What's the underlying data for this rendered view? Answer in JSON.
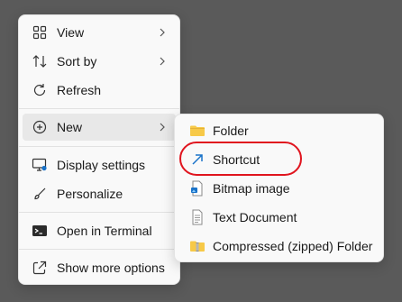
{
  "main_menu": {
    "items": [
      {
        "label": "View",
        "icon": "grid-icon",
        "has_submenu": true
      },
      {
        "label": "Sort by",
        "icon": "sort-icon",
        "has_submenu": true
      },
      {
        "label": "Refresh",
        "icon": "refresh-icon",
        "has_submenu": false
      },
      {
        "label": "New",
        "icon": "plus-circle-icon",
        "has_submenu": true
      },
      {
        "label": "Display settings",
        "icon": "display-icon",
        "has_submenu": false
      },
      {
        "label": "Personalize",
        "icon": "brush-icon",
        "has_submenu": false
      },
      {
        "label": "Open in Terminal",
        "icon": "terminal-icon",
        "has_submenu": false
      },
      {
        "label": "Show more options",
        "icon": "share-arrow-icon",
        "has_submenu": false
      }
    ]
  },
  "submenu": {
    "items": [
      {
        "label": "Folder",
        "icon": "folder-icon"
      },
      {
        "label": "Shortcut",
        "icon": "shortcut-arrow-icon"
      },
      {
        "label": "Bitmap image",
        "icon": "bitmap-file-icon"
      },
      {
        "label": "Text Document",
        "icon": "text-file-icon"
      },
      {
        "label": "Compressed (zipped) Folder",
        "icon": "zip-folder-icon"
      }
    ]
  },
  "colors": {
    "highlight_ring": "#e0141e",
    "folder": "#f7c948",
    "shortcut_arrow": "#1a73c9"
  }
}
